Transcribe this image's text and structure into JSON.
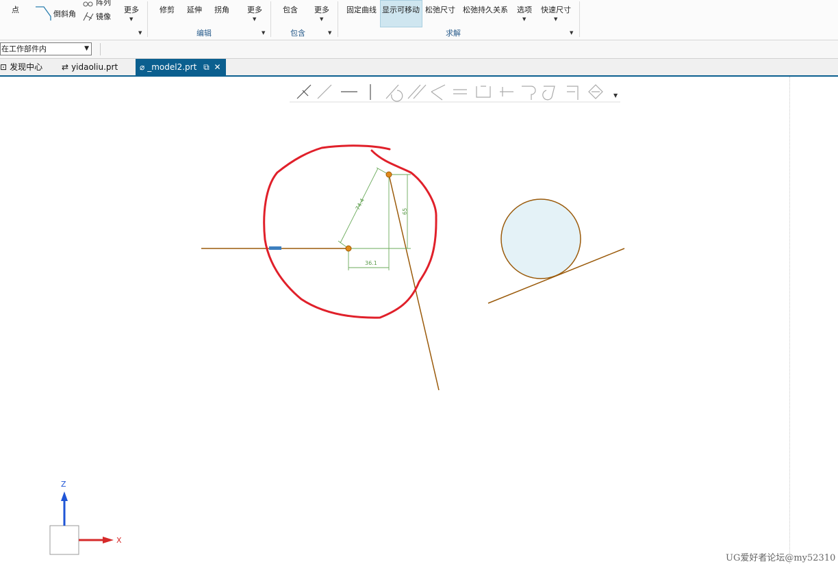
{
  "ribbon": {
    "point": "点",
    "chamfer": "倒斜角",
    "array": "阵列",
    "mirror": "镜像",
    "more1": "更多",
    "trim": "修剪",
    "extend": "延伸",
    "corner": "拐角",
    "more2": "更多",
    "edit_group": "编辑",
    "include": "包含",
    "more3": "更多",
    "include_group": "包含",
    "fix_curve": "固定曲线",
    "show_movable": "显示可移动",
    "relax_dim": "松弛尺寸",
    "relax_persist": "松弛持久关系",
    "options": "选项",
    "quick_dim": "快速尺寸",
    "solve_group": "求解"
  },
  "filter": {
    "scope": "在工作部件内"
  },
  "tabs": [
    {
      "label": "发现中心"
    },
    {
      "label": "yidaoliu.prt"
    },
    {
      "label": "_model2.prt"
    }
  ],
  "dimensions": {
    "d1": "74.4",
    "d2": "36.1",
    "d3": "65"
  },
  "axes": {
    "z": "Z",
    "x": "X"
  },
  "watermark": "UG爱好者论坛@my52310",
  "colors": {
    "curve": "#9a5a0a",
    "annotation": "#e0202a",
    "dimension": "#6aaa5a",
    "tab_active": "#0b5f8f",
    "circle_fill": "#e4f2f7"
  }
}
